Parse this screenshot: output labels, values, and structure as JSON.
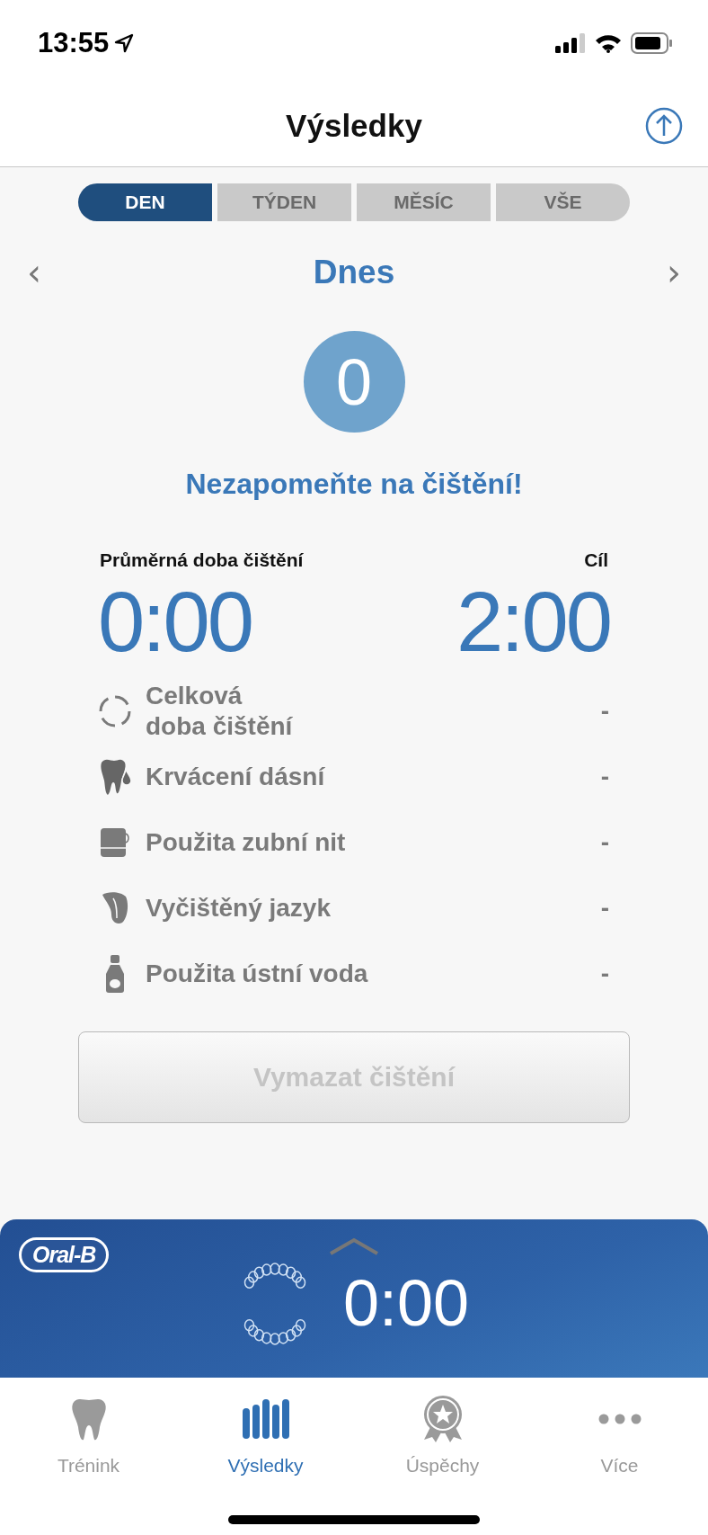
{
  "status_bar": {
    "time": "13:55"
  },
  "nav": {
    "title": "Výsledky"
  },
  "periods": [
    {
      "label": "DEN",
      "selected": true
    },
    {
      "label": "TÝDEN",
      "selected": false
    },
    {
      "label": "MĚSÍC",
      "selected": false
    },
    {
      "label": "VŠE",
      "selected": false
    }
  ],
  "date_nav": {
    "prev": "‹",
    "label": "Dnes",
    "next": "›"
  },
  "session_count": "0",
  "reminder": "Nezapomeňte na čištění!",
  "average": {
    "label": "Průměrná doba čištění",
    "value": "0:00"
  },
  "goal": {
    "label": "Cíl",
    "value": "2:00"
  },
  "stats": [
    {
      "kind": "timer",
      "label": "Celková\ndoba čištění",
      "value": "-"
    },
    {
      "kind": "gums",
      "label": "Krvácení dásní",
      "value": "-"
    },
    {
      "kind": "floss",
      "label": "Použita zubní nit",
      "value": "-"
    },
    {
      "kind": "tongue",
      "label": "Vyčištěný jazyk",
      "value": "-"
    },
    {
      "kind": "mouthwash",
      "label": "Použita ústní voda",
      "value": "-"
    }
  ],
  "delete_button": {
    "label": "Vymazat čištění",
    "disabled": true
  },
  "brush_panel": {
    "logo": "Oral-B",
    "timer": "0:00"
  },
  "tabs": [
    {
      "kind": "tooth",
      "label": "Trénink",
      "selected": false
    },
    {
      "kind": "bars",
      "label": "Výsledky",
      "selected": true
    },
    {
      "kind": "medal",
      "label": "Úspěchy",
      "selected": false
    },
    {
      "kind": "dots",
      "label": "Více",
      "selected": false
    }
  ]
}
